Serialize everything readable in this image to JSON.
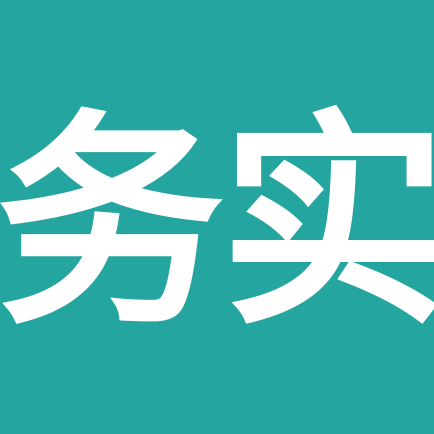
{
  "app_icon": {
    "logo_text": "务实",
    "background_color": "#25a5a0",
    "text_color": "#ffffff"
  }
}
